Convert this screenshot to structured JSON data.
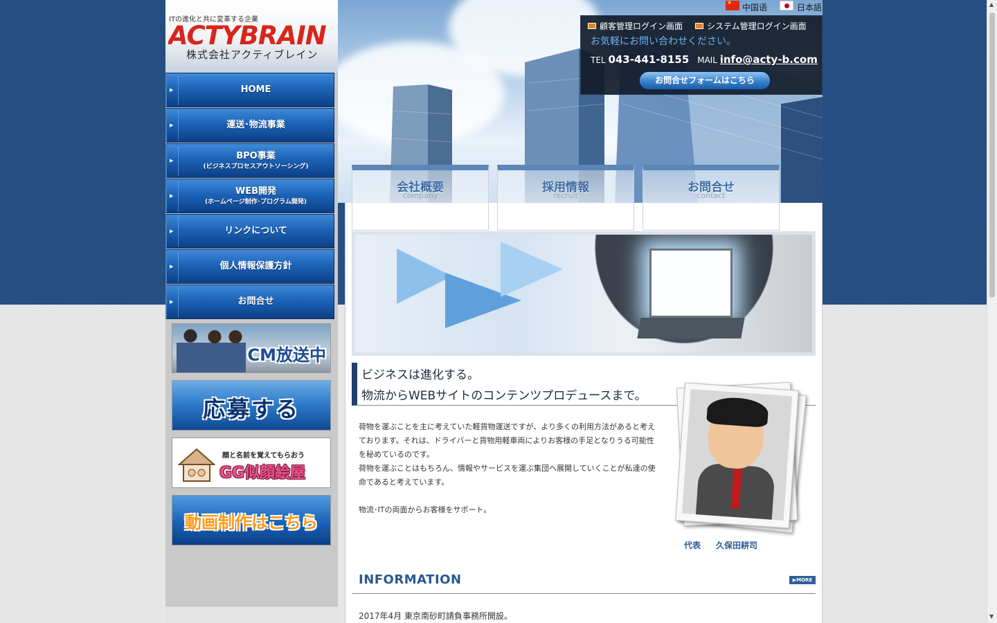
{
  "logo": {
    "tagline": "ITの進化と共に変革する企業",
    "brand": "ACTYBRAIN",
    "company": "株式会社アクティブレイン"
  },
  "languages": [
    {
      "label": "中国语",
      "icon": "china-flag-icon"
    },
    {
      "label": "日本語",
      "icon": "japan-flag-icon"
    }
  ],
  "contact_box": {
    "login_customer": "顧客管理ログイン画面",
    "login_system": "システム管理ログイン画面",
    "message": "お気軽にお問い合わせください。",
    "tel_label": "TEL",
    "tel": "043-441-8155",
    "mail_label": "MAIL",
    "mail": "info@acty-b.com",
    "form_button": "お問合せフォームはこちら"
  },
  "nav": [
    {
      "label": "HOME",
      "sub": ""
    },
    {
      "label": "運送･物流事業",
      "sub": ""
    },
    {
      "label": "BPO事業",
      "sub": "(ビジネスプロセスアウトソーシング)"
    },
    {
      "label": "WEB開発",
      "sub": "(ホームページ制作･プログラム開発)"
    },
    {
      "label": "リンクについて",
      "sub": ""
    },
    {
      "label": "個人情報保護方針",
      "sub": ""
    },
    {
      "label": "お問合せ",
      "sub": ""
    }
  ],
  "banners": {
    "cm": "CM放送中",
    "apply": "応募する",
    "gg_small": "顔と名前を覚えてもらおう",
    "gg_big": "GG似顔絵屋",
    "video": "動画制作はこちら"
  },
  "tabs": [
    {
      "jp": "会社概要",
      "en": "company"
    },
    {
      "jp": "採用情報",
      "en": "recruit"
    },
    {
      "jp": "お問合せ",
      "en": "contact"
    }
  ],
  "headline": {
    "line1": "ビジネスは進化する。",
    "line2": "物流からWEBサイトのコンテンツプロデュースまで。"
  },
  "body": {
    "p1": "荷物を運ぶことを主に考えていた軽貨物運送ですが、より多くの利用方法があると考えております。それは、ドライバーと貨物用軽車両によりお客様の手足となりうる可能性を秘めているのです。",
    "p2": "荷物を運ぶことはもちろん、情報やサービスを運ぶ集団へ展開していくことが私達の使命であると考えています。",
    "p3": "物流･ITの両面からお客様をサポート。"
  },
  "representative": {
    "title": "代表",
    "name": "久保田耕司"
  },
  "information": {
    "heading": "INFORMATION",
    "more": "MORE",
    "items": [
      "2017年4月 東京南砂町請負事務所開設。"
    ]
  },
  "colors": {
    "nav_blue": "#1d63b8",
    "accent_dark": "#1f3f6e",
    "heading_blue": "#2a5a8f"
  }
}
